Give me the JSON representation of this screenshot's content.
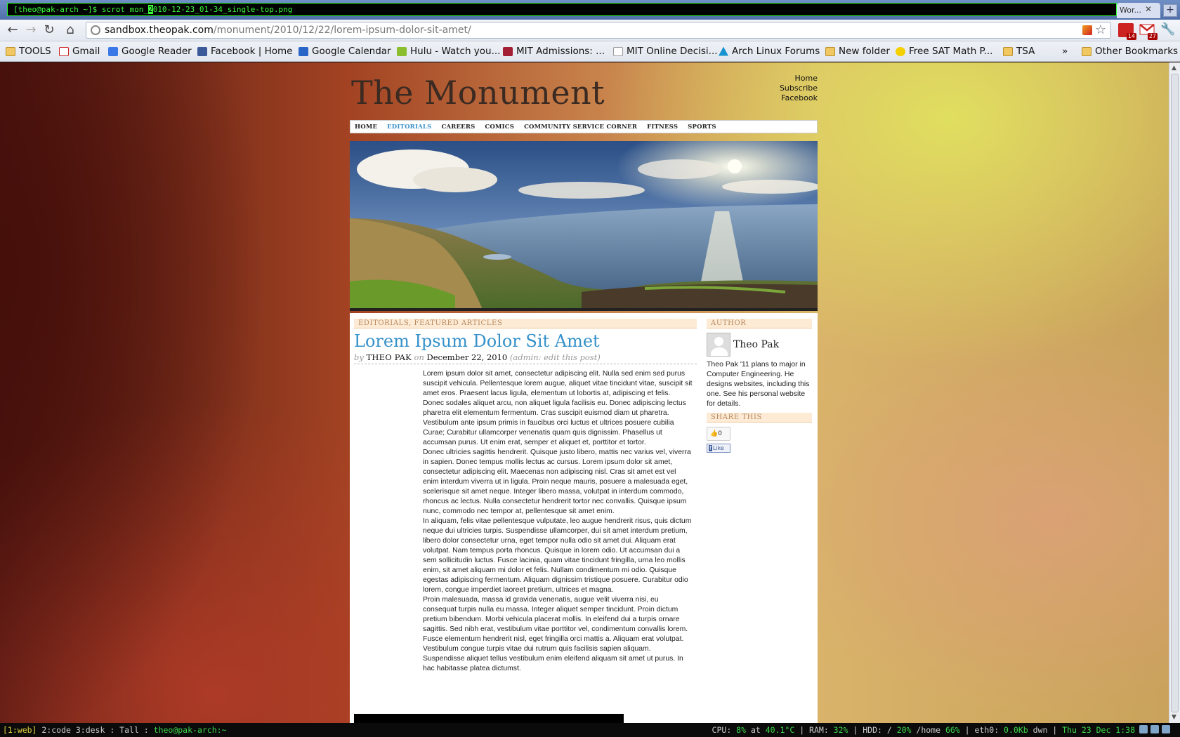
{
  "terminal": {
    "command_prefix": "[theo@pak-arch ~]$ scrot mon_",
    "cursor_char": "2",
    "command_suffix": "010-12-23_01-34_single-top.png"
  },
  "tab_fragment": "Wor...",
  "toolbar": {
    "url_host": "sandbox.theopak.com",
    "url_path": "/monument/2010/12/22/lorem-ipsum-dolor-sit-amet/",
    "ext_pdf_badge": "14",
    "ext_gmail_badge": "27"
  },
  "bookmarks": [
    {
      "label": "TOOLS",
      "icon": "folder-icon"
    },
    {
      "label": "Gmail",
      "icon": "gmail-icon"
    },
    {
      "label": "Google Reader",
      "icon": "reader-icon"
    },
    {
      "label": "Facebook | Home",
      "icon": "facebook-icon"
    },
    {
      "label": "Google Calendar",
      "icon": "calendar-icon"
    },
    {
      "label": "Hulu - Watch you...",
      "icon": "hulu-icon"
    },
    {
      "label": "MIT Admissions: ...",
      "icon": "mit-icon"
    },
    {
      "label": "MIT Online Decisi...",
      "icon": "page-icon"
    },
    {
      "label": "Arch Linux Forums",
      "icon": "arch-icon"
    },
    {
      "label": "New folder",
      "icon": "folder-icon"
    },
    {
      "label": "Free SAT Math P...",
      "icon": "sat-icon"
    },
    {
      "label": "TSA",
      "icon": "folder-icon"
    }
  ],
  "bookmarks_overflow": "»",
  "other_bookmarks": "Other Bookmarks",
  "site": {
    "title": "The Monument",
    "top_links": [
      "Home",
      "Subscribe",
      "Facebook"
    ],
    "menu": [
      {
        "label": "HOME",
        "active": false
      },
      {
        "label": "EDITORIALS",
        "active": true
      },
      {
        "label": "CAREERS",
        "active": false
      },
      {
        "label": "COMICS",
        "active": false
      },
      {
        "label": "COMMUNITY SERVICE CORNER",
        "active": false
      },
      {
        "label": "FITNESS",
        "active": false
      },
      {
        "label": "SPORTS",
        "active": false
      }
    ]
  },
  "post": {
    "categories": "EDITORIALS, FEATURED ARTICLES",
    "title": "Lorem Ipsum Dolor Sit Amet",
    "by": "by",
    "author": "THEO PAK",
    "on": "on",
    "date": "December 22, 2010",
    "edit": "(admin: edit this post)",
    "paragraphs": [
      "Lorem ipsum dolor sit amet, consectetur adipiscing elit. Nulla sed enim sed purus suscipit vehicula. Pellentesque lorem augue, aliquet vitae tincidunt vitae, suscipit sit amet eros. Praesent lacus ligula, elementum ut lobortis at, adipiscing et felis. Donec sodales aliquet arcu, non aliquet ligula facilisis eu. Donec adipiscing lectus pharetra elit elementum fermentum. Cras suscipit euismod diam ut pharetra. Vestibulum ante ipsum primis in faucibus orci luctus et ultrices posuere cubilia Curae; Curabitur ullamcorper venenatis quam quis dignissim. Phasellus ut accumsan purus. Ut enim erat, semper et aliquet et, porttitor et tortor.",
      "Donec ultricies sagittis hendrerit. Quisque justo libero, mattis nec varius vel, viverra in sapien. Donec tempus mollis lectus ac cursus. Lorem ipsum dolor sit amet, consectetur adipiscing elit. Maecenas non adipiscing nisl. Cras sit amet est vel enim interdum viverra ut in ligula. Proin neque mauris, posuere a malesuada eget, scelerisque sit amet neque. Integer libero massa, volutpat in interdum commodo, rhoncus ac lectus. Nulla consectetur hendrerit tortor nec convallis. Quisque ipsum nunc, commodo nec tempor at, pellentesque sit amet enim.",
      "In aliquam, felis vitae pellentesque vulputate, leo augue hendrerit risus, quis dictum neque dui ultricies turpis. Suspendisse ullamcorper, dui sit amet interdum pretium, libero dolor consectetur urna, eget tempor nulla odio sit amet dui. Aliquam erat volutpat. Nam tempus porta rhoncus. Quisque in lorem odio. Ut accumsan dui a sem sollicitudin luctus. Fusce lacinia, quam vitae tincidunt fringilla, urna leo mollis enim, sit amet aliquam mi dolor et felis. Nullam condimentum mi odio. Quisque egestas adipiscing fermentum. Aliquam dignissim tristique posuere. Curabitur odio lorem, congue imperdiet laoreet pretium, ultrices et magna.",
      "Proin malesuada, massa id gravida venenatis, augue velit viverra nisi, eu consequat turpis nulla eu massa. Integer aliquet semper tincidunt. Proin dictum pretium bibendum. Morbi vehicula placerat mollis. In eleifend dui a turpis ornare sagittis. Sed nibh erat, vestibulum vitae porttitor vel, condimentum convallis lorem. Fusce elementum hendrerit nisl, eget fringilla orci mattis a. Aliquam erat volutpat. Vestibulum congue turpis vitae dui rutrum quis facilisis sapien aliquam. Suspendisse aliquet tellus vestibulum enim eleifend aliquam sit amet ut purus. In hac habitasse platea dictumst."
    ]
  },
  "sidebar": {
    "author_heading": "AUTHOR",
    "author_name": "Theo Pak",
    "author_bio": "Theo Pak '11 plans to major in Computer Engineering. He designs websites, including this one. See his personal website for details.",
    "share_heading": "SHARE THIS",
    "like_count": "0",
    "fb_like": "Like"
  },
  "statusbar": {
    "ws_active": "[1:web]",
    "ws_rest": " 2:code 3:desk : Tall : ",
    "ws_host": "theo@pak-arch:~",
    "cpu_label": "CPU: ",
    "cpu_val": "8%",
    "cpu_at": " at ",
    "cpu_temp": "40.1°C",
    "ram_label": " | RAM: ",
    "ram_val": "32%",
    "hdd_label": " | HDD: / ",
    "hdd_root": "20%",
    "hdd_home_label": " /home ",
    "hdd_home": "66%",
    "net_label": " | eth0: ",
    "net_val": "0.0Kb",
    "net_dir": " dwn | ",
    "clock": "Thu 23 Dec  1:38"
  }
}
